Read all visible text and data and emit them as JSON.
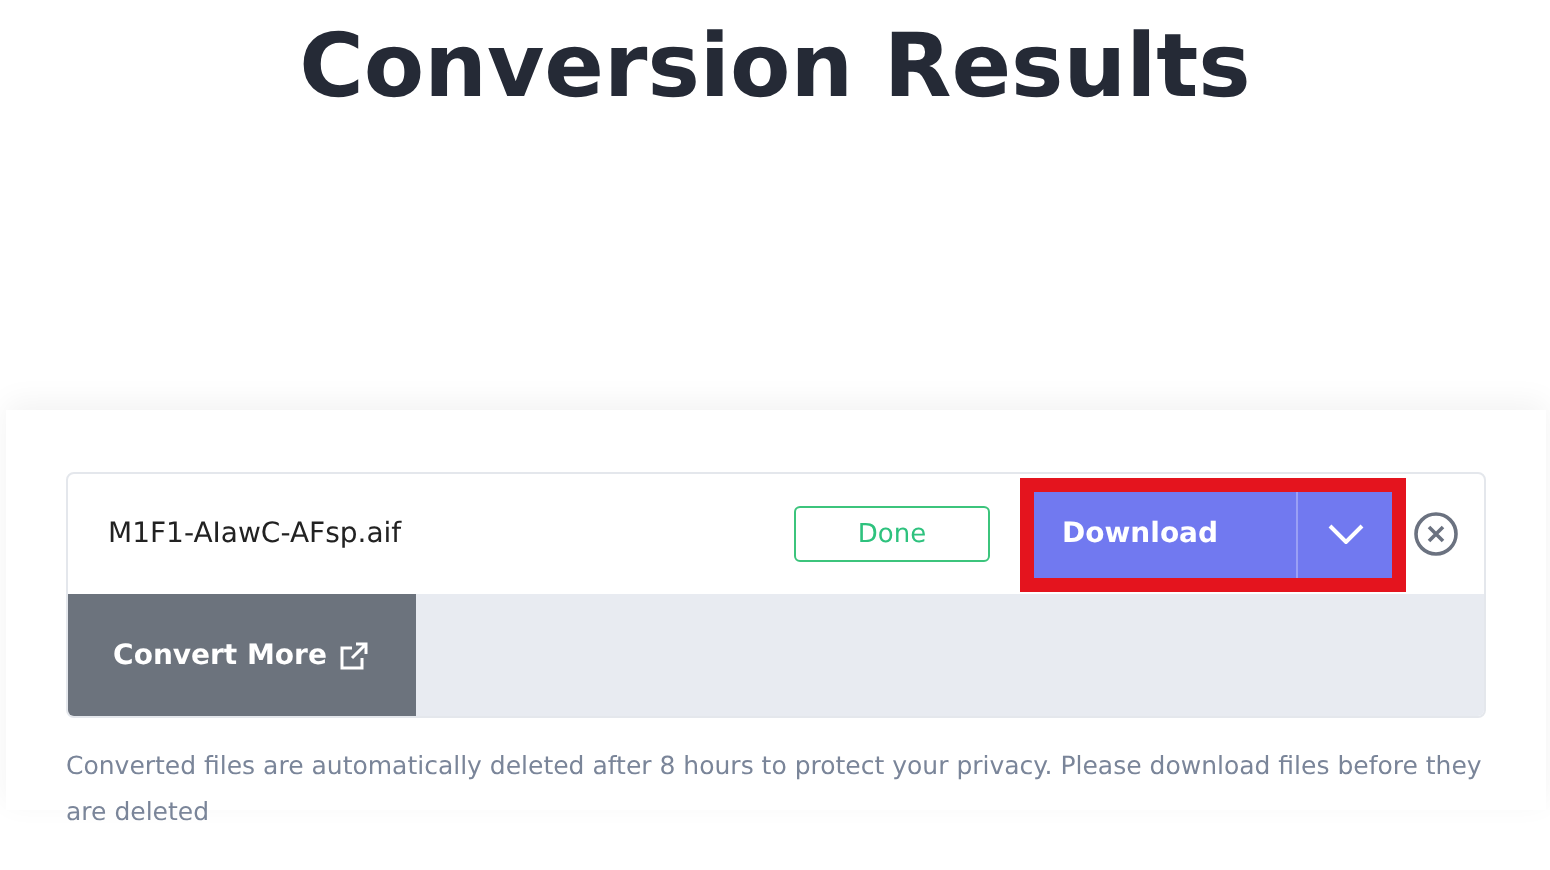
{
  "title": "Conversion Results",
  "files": [
    {
      "name": "M1F1-AIawC-AFsp.aif",
      "status": "Done",
      "download_label": "Download",
      "highlighted": true
    }
  ],
  "convert_more": "Convert More",
  "note": "Converted files are automatically deleted after 8 hours to protect your privacy. Please download files before they are deleted"
}
